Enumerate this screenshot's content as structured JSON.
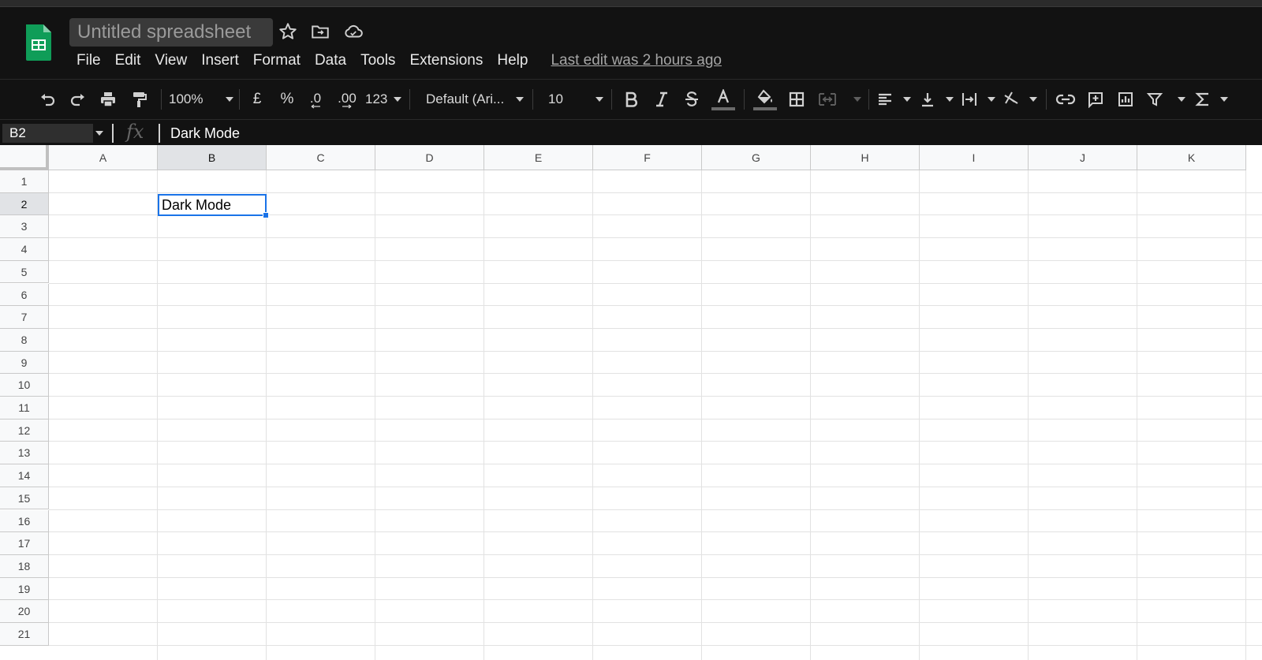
{
  "document": {
    "title": "Untitled spreadsheet",
    "last_edit": "Last edit was 2 hours ago"
  },
  "menu": [
    "File",
    "Edit",
    "View",
    "Insert",
    "Format",
    "Data",
    "Tools",
    "Extensions",
    "Help"
  ],
  "toolbar": {
    "zoom": "100%",
    "currency": "£",
    "percent": "%",
    "decrease_decimal": ".0",
    "increase_decimal": ".00",
    "more_formats": "123",
    "font": "Default (Ari...",
    "font_size": "10"
  },
  "formula_bar": {
    "name_box": "B2",
    "fx": "fx",
    "value": "Dark Mode"
  },
  "grid": {
    "columns": [
      "A",
      "B",
      "C",
      "D",
      "E",
      "F",
      "G",
      "H",
      "I",
      "J",
      "K"
    ],
    "rows": [
      "1",
      "2",
      "3",
      "4",
      "5",
      "6",
      "7",
      "8",
      "9",
      "10",
      "11",
      "12",
      "13",
      "14",
      "15",
      "16",
      "17",
      "18",
      "19",
      "20",
      "21"
    ],
    "selected_column": "B",
    "selected_row": "2",
    "cells": {
      "B2": "Dark Mode"
    }
  },
  "colors": {
    "accent": "#1a73e8",
    "toolbar_bg": "#121212",
    "sheets_green": "#0f9d58"
  },
  "icons": [
    "sheets-logo-icon",
    "star-icon",
    "move-folder-icon",
    "cloud-status-icon",
    "undo-icon",
    "redo-icon",
    "print-icon",
    "paint-format-icon",
    "bold-icon",
    "italic-icon",
    "strikethrough-icon",
    "text-color-icon",
    "fill-color-icon",
    "borders-icon",
    "merge-cells-icon",
    "horizontal-align-icon",
    "vertical-align-icon",
    "text-wrap-icon",
    "text-rotation-icon",
    "link-icon",
    "comment-icon",
    "chart-icon",
    "filter-icon",
    "functions-icon"
  ]
}
